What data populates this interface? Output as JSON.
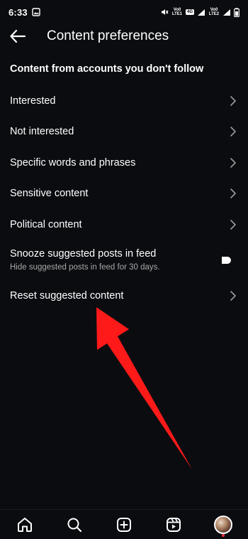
{
  "status_bar": {
    "time": "6:33",
    "network_1": "Vo0 LTE1",
    "network_2": "Vo0 LTE2",
    "badge": "4G"
  },
  "header": {
    "title": "Content preferences"
  },
  "section": {
    "heading": "Content from accounts you don't follow"
  },
  "menu": {
    "items": [
      {
        "label": "Interested"
      },
      {
        "label": "Not interested"
      },
      {
        "label": "Specific words and phrases"
      },
      {
        "label": "Sensitive content"
      },
      {
        "label": "Political content"
      }
    ],
    "snooze": {
      "title": "Snooze suggested posts in feed",
      "subtitle": "Hide suggested posts in feed for 30 days.",
      "enabled": false
    },
    "reset": {
      "label": "Reset suggested content"
    }
  },
  "annotation": {
    "arrow_color": "#ff1a1a"
  },
  "bottom_nav": {
    "items": [
      "home-icon",
      "search-icon",
      "create-icon",
      "reels-icon",
      "profile-avatar"
    ]
  },
  "colors": {
    "background": "#0b0c10",
    "text": "#ffffff",
    "subtext": "#a8a8a8",
    "notification_dot": "#ff3040"
  }
}
